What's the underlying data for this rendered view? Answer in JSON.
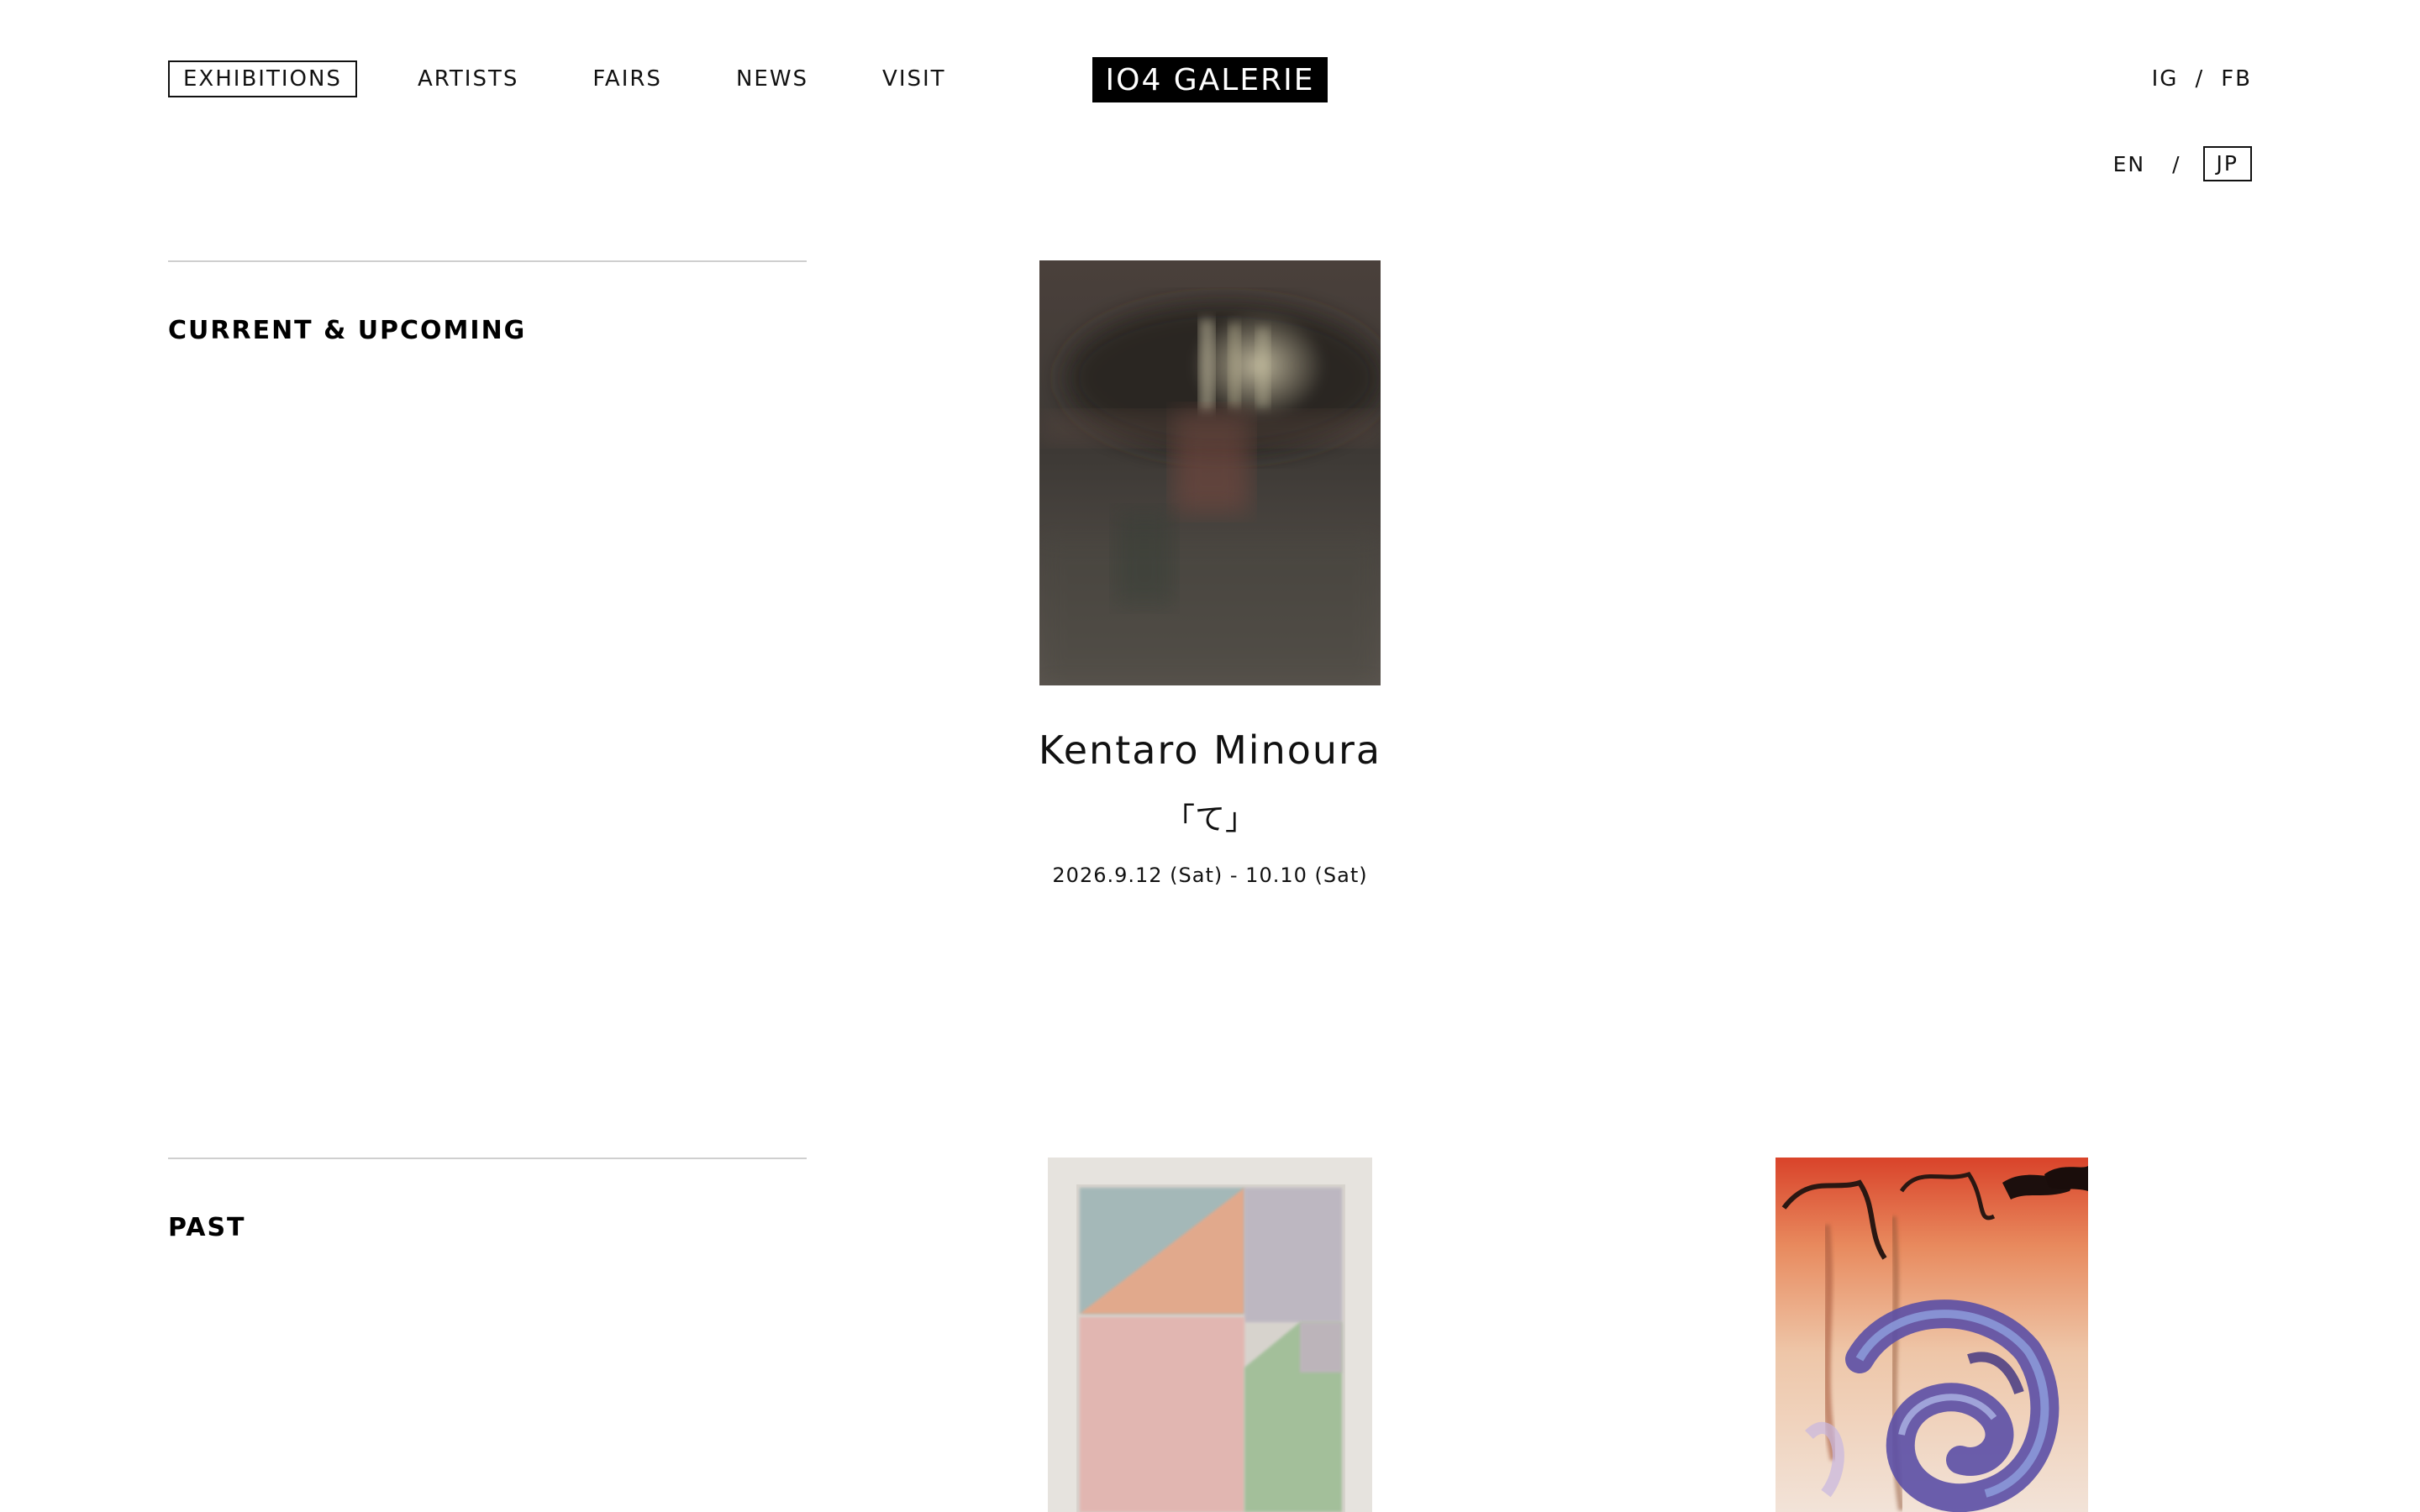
{
  "header": {
    "nav": [
      {
        "label": "EXHIBITIONS",
        "active": true
      },
      {
        "label": "ARTISTS"
      },
      {
        "label": "FAIRS"
      },
      {
        "label": "NEWS"
      },
      {
        "label": "VISIT"
      }
    ],
    "logo": "IO4 GALERIE",
    "social": {
      "ig": "IG",
      "separator": "/",
      "fb": "FB"
    },
    "language": {
      "en": "EN",
      "separator": "/",
      "jp": "JP",
      "active": "JP"
    }
  },
  "sections": {
    "current": {
      "title": "CURRENT & UPCOMING",
      "exhibition": {
        "artist": "Kentaro Minoura",
        "title": "「て」",
        "dates": "2026.9.12 (Sat) - 10.10 (Sat)"
      }
    },
    "past": {
      "title": "PAST"
    }
  },
  "colors": {
    "text": "#111111",
    "rule": "#cfcfcf",
    "logo_bg": "#000000"
  }
}
